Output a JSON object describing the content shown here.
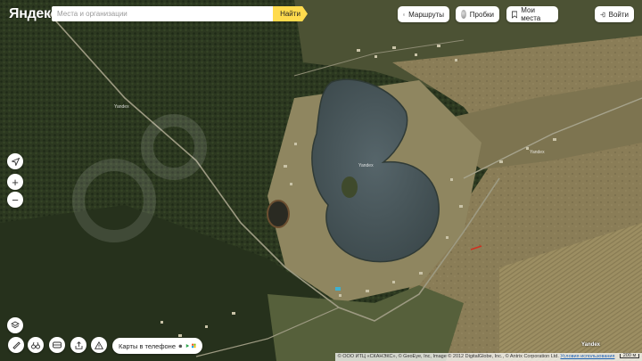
{
  "header": {
    "logo": "Яндекс",
    "search_placeholder": "Места и организации",
    "find_label": "Найти"
  },
  "toolbar": {
    "routes_label": "Маршруты",
    "traffic_label": "Пробки",
    "my_places_label": "Мои места",
    "login_label": "Войти"
  },
  "map_controls": {
    "locate_icon": "locate-arrow-icon",
    "zoom_in_symbol": "+",
    "zoom_out_symbol": "−",
    "layers_icon": "layers-icon"
  },
  "bottom_tools": {
    "ruler_icon": "ruler-icon",
    "route_icon": "binoculars-icon",
    "panorama_icon": "panorama-icon",
    "share_icon": "share-icon",
    "warning_icon": "warning-icon",
    "phone_label": "Карты в телефоне"
  },
  "map_labels": {
    "road1": "Yandex",
    "road2": "Yandex",
    "road3": "Yandex",
    "corner": "Yandex"
  },
  "attribution": {
    "text": "© ООО ИТЦ «СКАНЭКС», © GeoEye, Inc, Image © 2012 DigitalGlobe, Inc., © Antrix Corporation Ltd.",
    "terms": "Условия использования",
    "scale": "200 м"
  },
  "colors": {
    "accent": "#ffdb4d",
    "forest": "#2e3a22",
    "field": "#8a7f57",
    "lake": "#4b5a5c"
  }
}
